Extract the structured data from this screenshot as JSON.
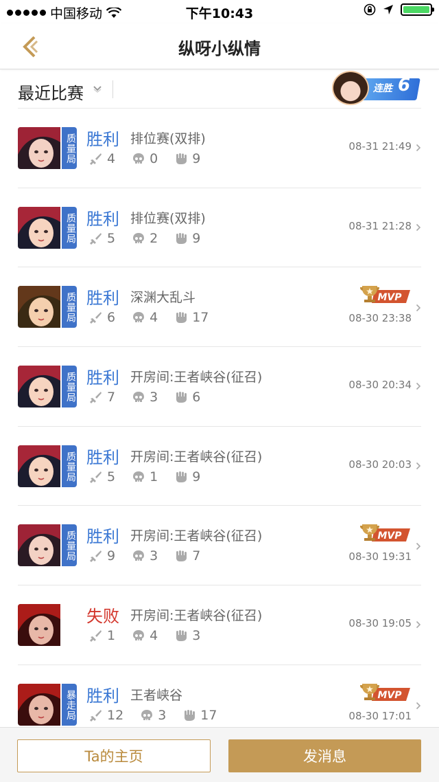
{
  "status_bar": {
    "carrier": "中国移动",
    "time": "下午10:43"
  },
  "nav": {
    "title": "纵呀小纵情"
  },
  "filter": {
    "label": "最近比赛"
  },
  "streak": {
    "label": "连胜",
    "count": "6"
  },
  "matches": [
    {
      "result": "胜利",
      "outcome": "win",
      "mode": "排位赛(双排)",
      "kills": "4",
      "deaths": "0",
      "assists": "9",
      "time": "08-31 21:49",
      "tag": "质量局",
      "mvp": false
    },
    {
      "result": "胜利",
      "outcome": "win",
      "mode": "排位赛(双排)",
      "kills": "5",
      "deaths": "2",
      "assists": "9",
      "time": "08-31 21:28",
      "tag": "质量局",
      "mvp": false
    },
    {
      "result": "胜利",
      "outcome": "win",
      "mode": "深渊大乱斗",
      "kills": "6",
      "deaths": "4",
      "assists": "17",
      "time": "08-30 23:38",
      "tag": "质量局",
      "mvp": true
    },
    {
      "result": "胜利",
      "outcome": "win",
      "mode": "开房间:王者峡谷(征召)",
      "kills": "7",
      "deaths": "3",
      "assists": "6",
      "time": "08-30 20:34",
      "tag": "质量局",
      "mvp": false
    },
    {
      "result": "胜利",
      "outcome": "win",
      "mode": "开房间:王者峡谷(征召)",
      "kills": "5",
      "deaths": "1",
      "assists": "9",
      "time": "08-30 20:03",
      "tag": "质量局",
      "mvp": false
    },
    {
      "result": "胜利",
      "outcome": "win",
      "mode": "开房间:王者峡谷(征召)",
      "kills": "9",
      "deaths": "3",
      "assists": "7",
      "time": "08-30 19:31",
      "tag": "质量局",
      "mvp": true
    },
    {
      "result": "失败",
      "outcome": "lose",
      "mode": "开房间:王者峡谷(征召)",
      "kills": "1",
      "deaths": "4",
      "assists": "3",
      "time": "08-30 19:05",
      "tag": "",
      "mvp": false
    },
    {
      "result": "胜利",
      "outcome": "win",
      "mode": "王者峡谷",
      "kills": "12",
      "deaths": "3",
      "assists": "17",
      "time": "08-30 17:01",
      "tag": "暴走局",
      "mvp": true
    }
  ],
  "mvp_label": "MVP",
  "footer": {
    "home_label": "Ta的主页",
    "message_label": "发消息"
  },
  "colors": {
    "win": "#3b78d4",
    "lose": "#d3362c",
    "gold": "#c49a56",
    "tag_blue": "#3f72c8"
  },
  "icons": {
    "kills": "sword-icon",
    "deaths": "skull-icon",
    "assists": "fist-icon"
  }
}
